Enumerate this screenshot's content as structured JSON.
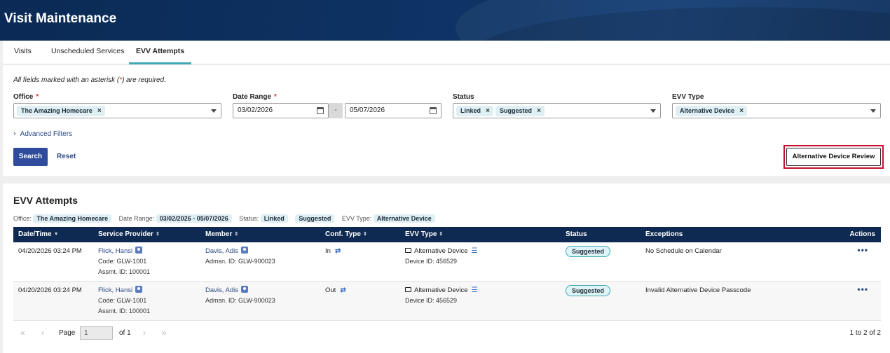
{
  "header": {
    "title": "Visit Maintenance"
  },
  "tabs": [
    {
      "label": "Visits"
    },
    {
      "label": "Unscheduled Services"
    },
    {
      "label": "EVV Attempts"
    }
  ],
  "filters": {
    "required_note_prefix": "All fields marked with an asterisk (",
    "required_note_star": "*",
    "required_note_suffix": ") are required.",
    "office": {
      "label": "Office",
      "chips": [
        "The Amazing Homecare"
      ]
    },
    "date_range": {
      "label": "Date Range",
      "from": "03/02/2026",
      "to": "05/07/2026",
      "separator": "-"
    },
    "status": {
      "label": "Status",
      "chips": [
        "Linked",
        "Suggested"
      ]
    },
    "evv_type": {
      "label": "EVV Type",
      "chips": [
        "Alternative Device"
      ]
    },
    "asterisk": "*",
    "chip_close": "×",
    "advanced_filters": "Advanced Filters",
    "search_label": "Search",
    "reset_label": "Reset",
    "review_button_label": "Alternative Device Review"
  },
  "results": {
    "title": "EVV Attempts",
    "summary": {
      "office_key": "Office:",
      "office_val": "The Amazing Homecare",
      "date_key": "Date Range:",
      "date_val": "03/02/2026 - 05/07/2026",
      "status_key": "Status:",
      "status_vals": [
        "Linked",
        "Suggested"
      ],
      "evv_key": "EVV Type:",
      "evv_val": "Alternative Device"
    },
    "columns": [
      "Date/Time",
      "Service Provider",
      "Member",
      "Conf. Type",
      "EVV Type",
      "Status",
      "Exceptions",
      "Actions"
    ],
    "rows": [
      {
        "datetime": "04/20/2026 03:24 PM",
        "provider": "Flick, Hansi",
        "provider_code": "Code: GLW-1001",
        "provider_assmt": "Assmt. ID: 100001",
        "member": "Davis, Adis",
        "member_admsn": "Admsn. ID: GLW-900023",
        "conf_type": "In",
        "evv_type": "Alternative Device",
        "device_id": "Device ID: 456529",
        "status": "Suggested",
        "exception": "No Schedule on Calendar"
      },
      {
        "datetime": "04/20/2026 03:24 PM",
        "provider": "Flick, Hansi",
        "provider_code": "Code: GLW-1001",
        "provider_assmt": "Assmt. ID: 100001",
        "member": "Davis, Adis",
        "member_admsn": "Admsn. ID: GLW-900023",
        "conf_type": "Out",
        "evv_type": "Alternative Device",
        "device_id": "Device ID: 456529",
        "status": "Suggested",
        "exception": "Invalid Alternative Device Passcode"
      }
    ],
    "actions_glyph": "•••"
  },
  "pager": {
    "page_label": "Page",
    "page_value": "1",
    "of_label": "of 1",
    "count": "1 to 2 of 2"
  },
  "icons": {
    "first": "«",
    "prev": "‹",
    "next": "›",
    "last": "»",
    "sync": "⇄",
    "list": "☰",
    "chevron": "›",
    "sort_desc": "▼",
    "sort_both": "⇕"
  }
}
